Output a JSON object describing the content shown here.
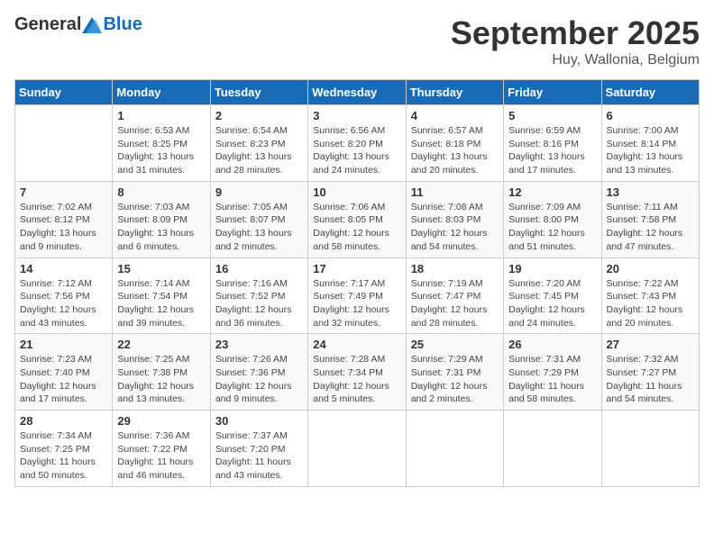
{
  "header": {
    "logo_general": "General",
    "logo_blue": "Blue",
    "month_title": "September 2025",
    "location": "Huy, Wallonia, Belgium"
  },
  "days_of_week": [
    "Sunday",
    "Monday",
    "Tuesday",
    "Wednesday",
    "Thursday",
    "Friday",
    "Saturday"
  ],
  "weeks": [
    [
      {
        "day": "",
        "info": ""
      },
      {
        "day": "1",
        "info": "Sunrise: 6:53 AM\nSunset: 8:25 PM\nDaylight: 13 hours\nand 31 minutes."
      },
      {
        "day": "2",
        "info": "Sunrise: 6:54 AM\nSunset: 8:23 PM\nDaylight: 13 hours\nand 28 minutes."
      },
      {
        "day": "3",
        "info": "Sunrise: 6:56 AM\nSunset: 8:20 PM\nDaylight: 13 hours\nand 24 minutes."
      },
      {
        "day": "4",
        "info": "Sunrise: 6:57 AM\nSunset: 8:18 PM\nDaylight: 13 hours\nand 20 minutes."
      },
      {
        "day": "5",
        "info": "Sunrise: 6:59 AM\nSunset: 8:16 PM\nDaylight: 13 hours\nand 17 minutes."
      },
      {
        "day": "6",
        "info": "Sunrise: 7:00 AM\nSunset: 8:14 PM\nDaylight: 13 hours\nand 13 minutes."
      }
    ],
    [
      {
        "day": "7",
        "info": "Sunrise: 7:02 AM\nSunset: 8:12 PM\nDaylight: 13 hours\nand 9 minutes."
      },
      {
        "day": "8",
        "info": "Sunrise: 7:03 AM\nSunset: 8:09 PM\nDaylight: 13 hours\nand 6 minutes."
      },
      {
        "day": "9",
        "info": "Sunrise: 7:05 AM\nSunset: 8:07 PM\nDaylight: 13 hours\nand 2 minutes."
      },
      {
        "day": "10",
        "info": "Sunrise: 7:06 AM\nSunset: 8:05 PM\nDaylight: 12 hours\nand 58 minutes."
      },
      {
        "day": "11",
        "info": "Sunrise: 7:08 AM\nSunset: 8:03 PM\nDaylight: 12 hours\nand 54 minutes."
      },
      {
        "day": "12",
        "info": "Sunrise: 7:09 AM\nSunset: 8:00 PM\nDaylight: 12 hours\nand 51 minutes."
      },
      {
        "day": "13",
        "info": "Sunrise: 7:11 AM\nSunset: 7:58 PM\nDaylight: 12 hours\nand 47 minutes."
      }
    ],
    [
      {
        "day": "14",
        "info": "Sunrise: 7:12 AM\nSunset: 7:56 PM\nDaylight: 12 hours\nand 43 minutes."
      },
      {
        "day": "15",
        "info": "Sunrise: 7:14 AM\nSunset: 7:54 PM\nDaylight: 12 hours\nand 39 minutes."
      },
      {
        "day": "16",
        "info": "Sunrise: 7:16 AM\nSunset: 7:52 PM\nDaylight: 12 hours\nand 36 minutes."
      },
      {
        "day": "17",
        "info": "Sunrise: 7:17 AM\nSunset: 7:49 PM\nDaylight: 12 hours\nand 32 minutes."
      },
      {
        "day": "18",
        "info": "Sunrise: 7:19 AM\nSunset: 7:47 PM\nDaylight: 12 hours\nand 28 minutes."
      },
      {
        "day": "19",
        "info": "Sunrise: 7:20 AM\nSunset: 7:45 PM\nDaylight: 12 hours\nand 24 minutes."
      },
      {
        "day": "20",
        "info": "Sunrise: 7:22 AM\nSunset: 7:43 PM\nDaylight: 12 hours\nand 20 minutes."
      }
    ],
    [
      {
        "day": "21",
        "info": "Sunrise: 7:23 AM\nSunset: 7:40 PM\nDaylight: 12 hours\nand 17 minutes."
      },
      {
        "day": "22",
        "info": "Sunrise: 7:25 AM\nSunset: 7:38 PM\nDaylight: 12 hours\nand 13 minutes."
      },
      {
        "day": "23",
        "info": "Sunrise: 7:26 AM\nSunset: 7:36 PM\nDaylight: 12 hours\nand 9 minutes."
      },
      {
        "day": "24",
        "info": "Sunrise: 7:28 AM\nSunset: 7:34 PM\nDaylight: 12 hours\nand 5 minutes."
      },
      {
        "day": "25",
        "info": "Sunrise: 7:29 AM\nSunset: 7:31 PM\nDaylight: 12 hours\nand 2 minutes."
      },
      {
        "day": "26",
        "info": "Sunrise: 7:31 AM\nSunset: 7:29 PM\nDaylight: 11 hours\nand 58 minutes."
      },
      {
        "day": "27",
        "info": "Sunrise: 7:32 AM\nSunset: 7:27 PM\nDaylight: 11 hours\nand 54 minutes."
      }
    ],
    [
      {
        "day": "28",
        "info": "Sunrise: 7:34 AM\nSunset: 7:25 PM\nDaylight: 11 hours\nand 50 minutes."
      },
      {
        "day": "29",
        "info": "Sunrise: 7:36 AM\nSunset: 7:22 PM\nDaylight: 11 hours\nand 46 minutes."
      },
      {
        "day": "30",
        "info": "Sunrise: 7:37 AM\nSunset: 7:20 PM\nDaylight: 11 hours\nand 43 minutes."
      },
      {
        "day": "",
        "info": ""
      },
      {
        "day": "",
        "info": ""
      },
      {
        "day": "",
        "info": ""
      },
      {
        "day": "",
        "info": ""
      }
    ]
  ]
}
